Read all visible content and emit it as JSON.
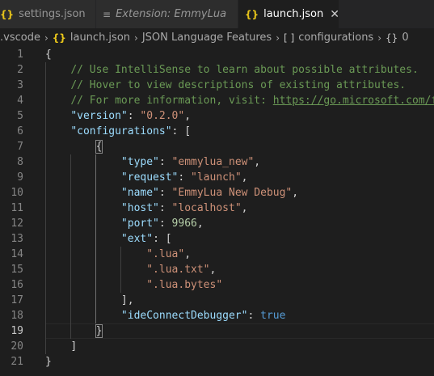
{
  "tabs": [
    {
      "icon": "{}",
      "label": "settings.json"
    },
    {
      "icon": "≡",
      "label": "Extension: EmmyLua"
    },
    {
      "icon": "{}",
      "label": "launch.json",
      "close": "✕"
    }
  ],
  "breadcrumb": {
    "folder": ".vscode",
    "file": "launch.json",
    "schema": "JSON Language Features",
    "array_icon": "[ ]",
    "array": "configurations",
    "object_icon": "{}",
    "object": "0"
  },
  "line_numbers": [
    "1",
    "2",
    "3",
    "4",
    "5",
    "6",
    "7",
    "8",
    "9",
    "10",
    "11",
    "12",
    "13",
    "14",
    "15",
    "16",
    "17",
    "18",
    "19",
    "20",
    "21"
  ],
  "code": {
    "l1_brace": "{",
    "comment1": "// Use IntelliSense to learn about possible attributes.",
    "comment2": "// Hover to view descriptions of existing attributes.",
    "comment3": "// For more information, visit: ",
    "comment3_link": "https://go.microsoft.com/fw",
    "version_key": "\"version\"",
    "version_val": "\"0.2.0\"",
    "configurations_key": "\"configurations\"",
    "l6_open": "[",
    "l7_brace": "{",
    "type_key": "\"type\"",
    "type_val": "\"emmylua_new\"",
    "request_key": "\"request\"",
    "request_val": "\"launch\"",
    "name_key": "\"name\"",
    "name_val": "\"EmmyLua New Debug\"",
    "host_key": "\"host\"",
    "host_val": "\"localhost\"",
    "port_key": "\"port\"",
    "port_val": "9966",
    "ext_key": "\"ext\"",
    "l13_open": "[",
    "ext_1": "\".lua\"",
    "ext_2": "\".lua.txt\"",
    "ext_3": "\".lua.bytes\"",
    "l17_close": "]",
    "ide_key": "\"ideConnectDebugger\"",
    "ide_val": "true",
    "l19_brace": "}",
    "l20_close": "]",
    "l21_brace": "}"
  }
}
